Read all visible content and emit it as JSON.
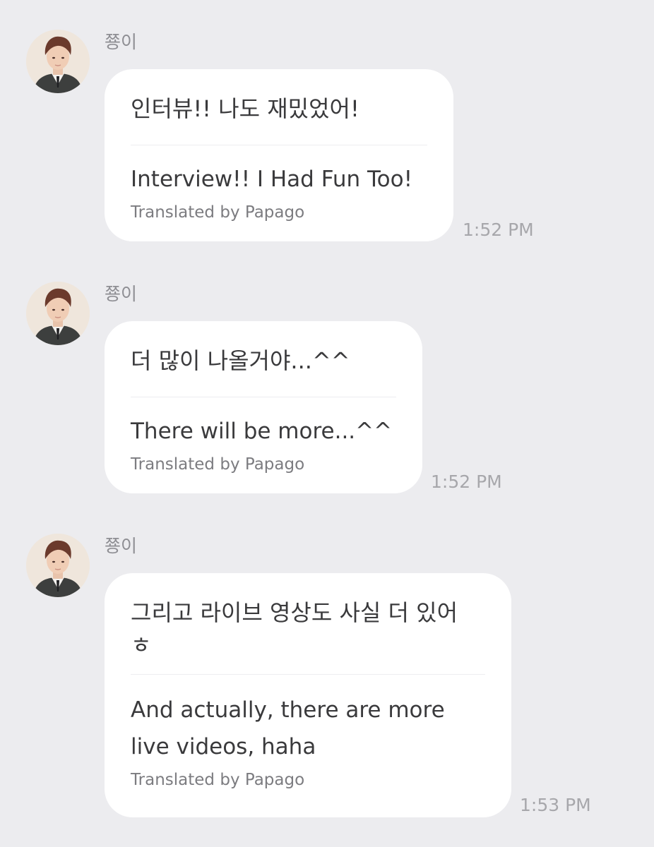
{
  "messages": [
    {
      "sender": "쭁이",
      "original": "인터뷰!! 나도 재밌었어!",
      "translated": "Interview!! I Had Fun Too!",
      "credit": "Translated by Papago",
      "time": "1:52 PM"
    },
    {
      "sender": "쭁이",
      "original": "더 많이 나올거야...^^",
      "translated": "There will be more...^^",
      "credit": "Translated by Papago",
      "time": "1:52 PM"
    },
    {
      "sender": "쭁이",
      "original": "그리고 라이브 영상도 사실 더 있어 ㅎ",
      "translated": "And actually, there are more live videos, haha",
      "credit": "Translated by Papago",
      "time": "1:53 PM"
    }
  ]
}
